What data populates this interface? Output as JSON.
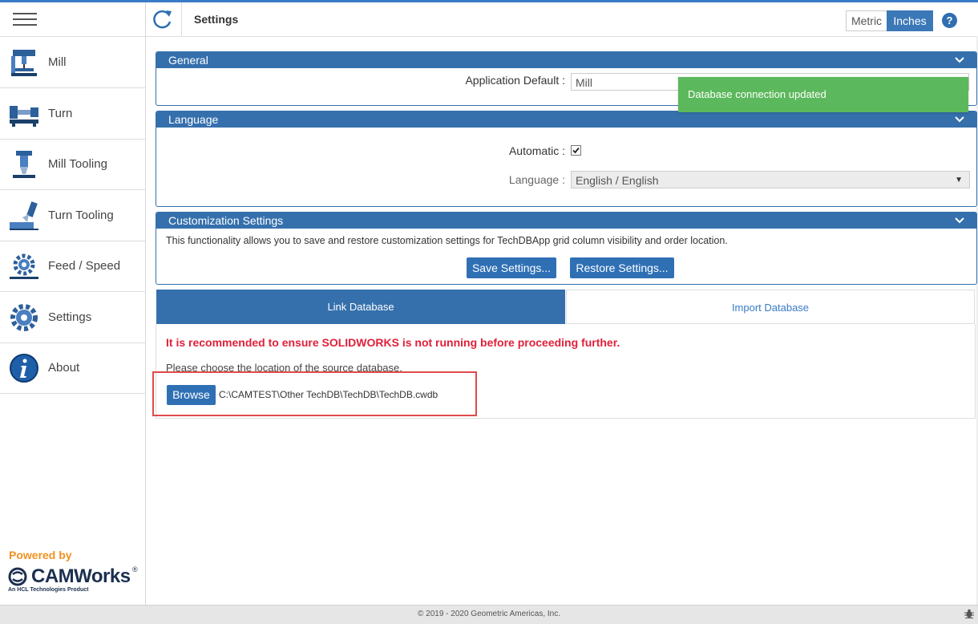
{
  "header": {
    "title": "Settings",
    "units": [
      "Metric",
      "Inches"
    ],
    "active_unit": "Inches",
    "help_glyph": "?"
  },
  "sidebar": {
    "items": [
      {
        "label": "Mill",
        "icon": "mill-machine-icon"
      },
      {
        "label": "Turn",
        "icon": "lathe-icon"
      },
      {
        "label": "Mill Tooling",
        "icon": "mill-tool-icon"
      },
      {
        "label": "Turn Tooling",
        "icon": "turn-tool-icon"
      },
      {
        "label": "Feed / Speed",
        "icon": "feed-speed-gear-icon"
      },
      {
        "label": "Settings",
        "icon": "gear-icon"
      },
      {
        "label": "About",
        "icon": "info-icon"
      }
    ],
    "powered_by": "Powered by",
    "brand": "CAMWorks",
    "brand_reg": "®",
    "brand_sub": "An HCL Technologies Product"
  },
  "general": {
    "title": "General",
    "app_default_label": "Application Default :",
    "app_default_value": "Mill"
  },
  "language": {
    "title": "Language",
    "automatic_label": "Automatic :",
    "automatic_checked": true,
    "language_label": "Language :",
    "language_value": "English / English"
  },
  "customization": {
    "title": "Customization Settings",
    "description": "This functionality allows you to save and restore customization settings for TechDBApp grid column visibility and order location.",
    "save_label": "Save Settings...",
    "restore_label": "Restore Settings..."
  },
  "tabs": {
    "link": "Link Database",
    "import": "Import Database",
    "active": "Link Database"
  },
  "link_database": {
    "warning": "It is recommended to ensure SOLIDWORKS is not running before proceeding further.",
    "instruction": "Please choose the location of the source database.",
    "browse_label": "Browse",
    "path": "C:\\CAMTEST\\Other TechDB\\TechDB\\TechDB.cwdb"
  },
  "toast": {
    "message": "Database connection updated"
  },
  "footer": {
    "copyright": "© 2019 - 2020 Geometric Americas, Inc."
  },
  "colors": {
    "primary": "#3570ad",
    "warning": "#e0203a",
    "toast": "#5cb85c",
    "powered": "#f0901e"
  }
}
